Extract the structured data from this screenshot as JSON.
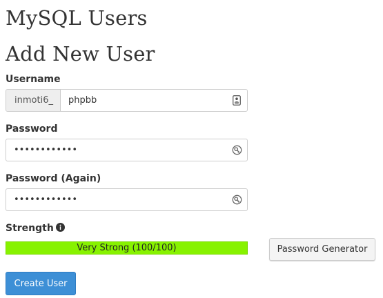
{
  "page": {
    "title": "MySQL Users",
    "section_title": "Add New User"
  },
  "form": {
    "username": {
      "label": "Username",
      "prefix": "inmoti6_",
      "value": "phpbb",
      "icon": "contact-card-icon"
    },
    "password": {
      "label": "Password",
      "value": "••••••••••••",
      "icon": "key-icon"
    },
    "password_again": {
      "label": "Password (Again)",
      "value": "••••••••••••",
      "icon": "key-icon"
    },
    "strength": {
      "label": "Strength",
      "info_icon": "info-icon",
      "text": "Very Strong (100/100)",
      "score": 100,
      "max": 100,
      "color": "#87f200"
    },
    "password_generator_label": "Password Generator",
    "create_user_label": "Create User"
  },
  "colors": {
    "primary_button": "#3d8fd6",
    "strength_bar": "#87f200"
  }
}
